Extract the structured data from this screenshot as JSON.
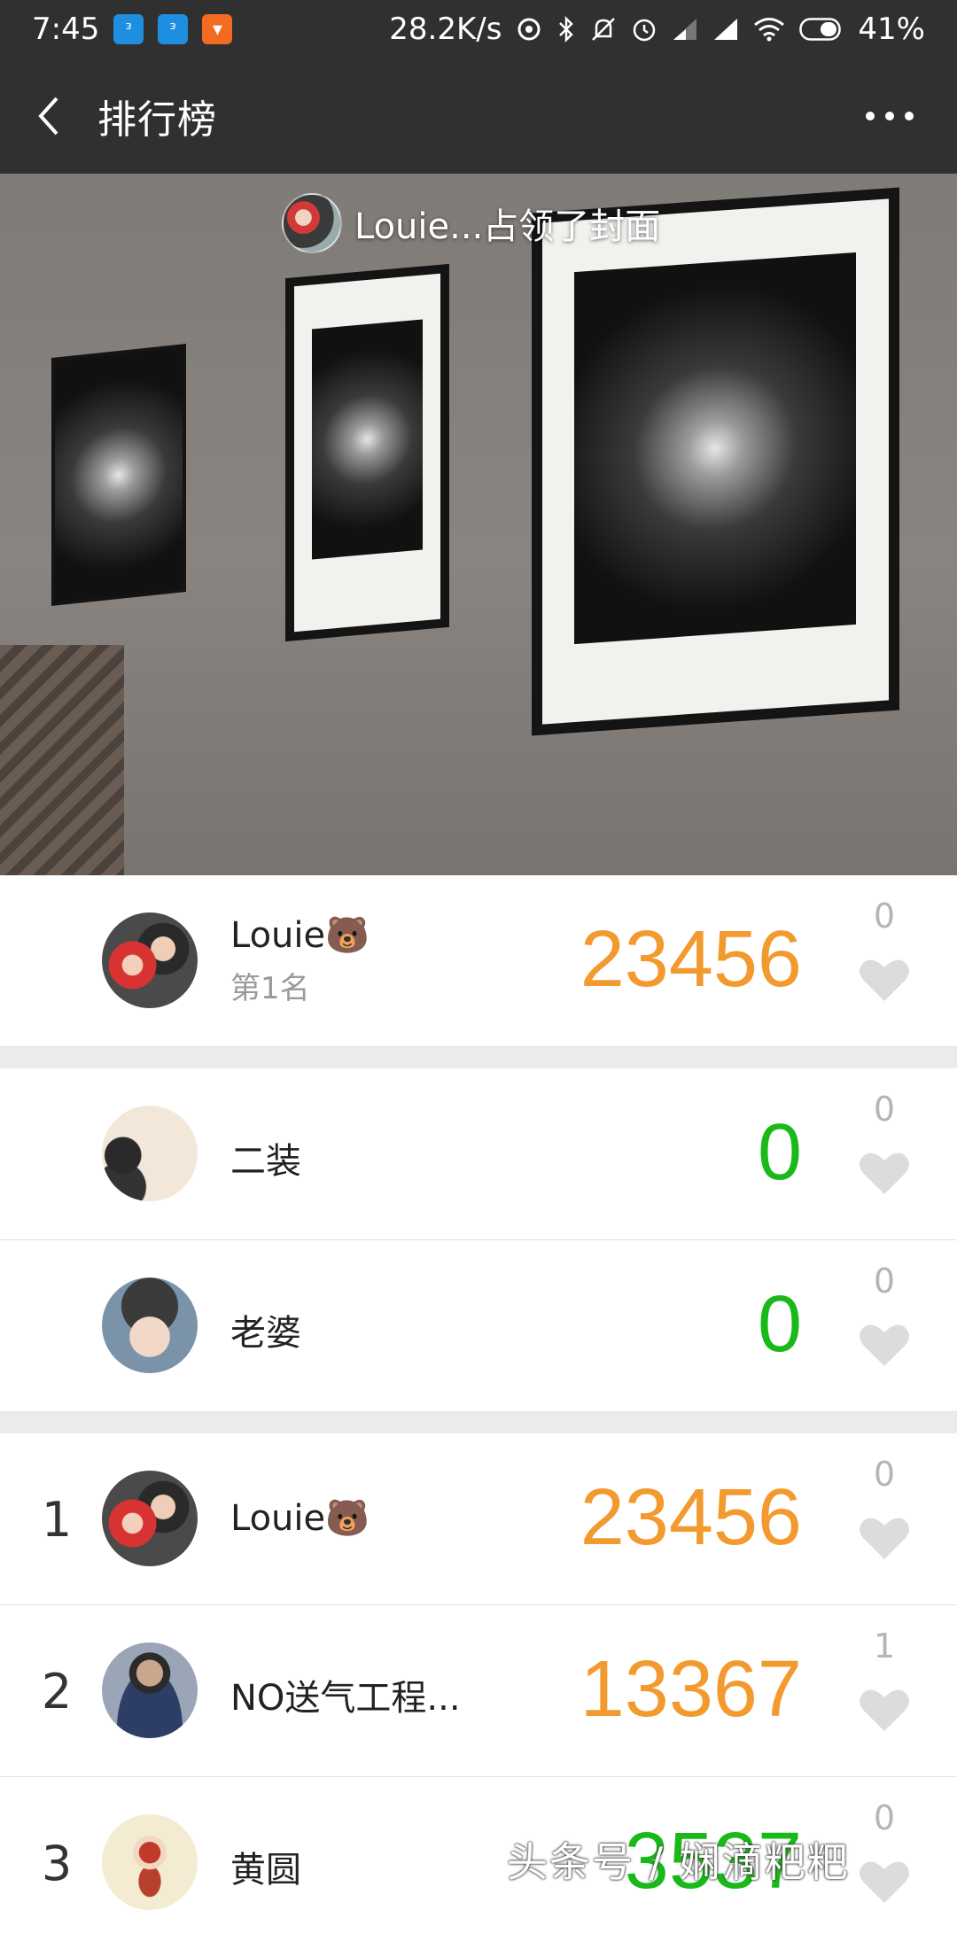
{
  "status_bar": {
    "time": "7:45",
    "net_speed": "28.2K/s",
    "battery": "41%"
  },
  "header": {
    "title": "排行榜"
  },
  "cover": {
    "text": "Louie...占领了封面"
  },
  "my_rank": {
    "name": "Louie",
    "emoji": "🐻",
    "subtitle": "第1名",
    "steps": "23456",
    "likes": "0"
  },
  "favorites": [
    {
      "name": "二装",
      "steps": "0",
      "likes": "0"
    },
    {
      "name": "老婆",
      "steps": "0",
      "likes": "0"
    }
  ],
  "ranking": [
    {
      "rank": "1",
      "name": "Louie",
      "emoji": "🐻",
      "steps": "23456",
      "likes": "0"
    },
    {
      "rank": "2",
      "name": "NO送气工程...",
      "steps": "13367",
      "likes": "1"
    },
    {
      "rank": "3",
      "name": "黄圆",
      "steps": "3537",
      "likes": "0"
    }
  ],
  "watermark": "头条号 / 娴滴粑粑",
  "colors": {
    "bar_bg": "#303030",
    "steps_high": "#f39a2f",
    "steps_zero": "#1ab91a",
    "separator": "#ebebeb"
  }
}
